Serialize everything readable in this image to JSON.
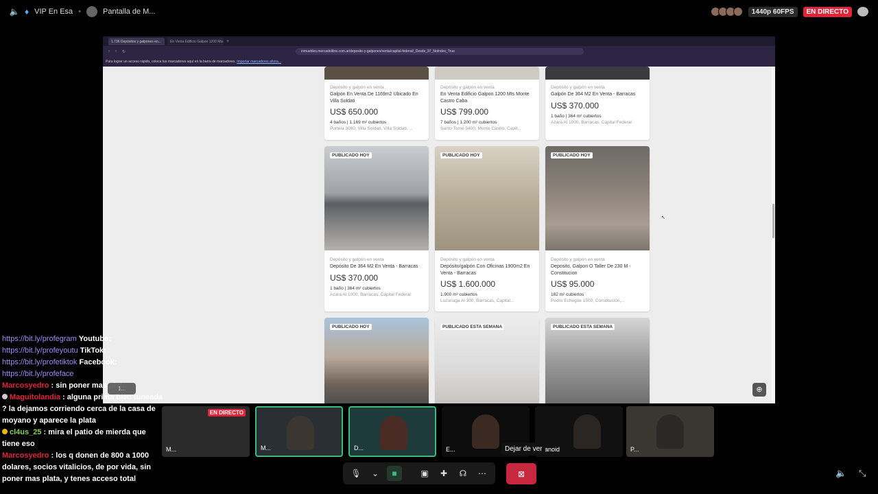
{
  "topbar": {
    "server": "VIP En Esa",
    "activity": "Pantalla de M...",
    "quality": "1440p 60FPS",
    "live": "EN DIRECTO"
  },
  "browser": {
    "tabs": [
      "1.736 Depósitos y galpones en...",
      "En Venta Edificio Galpon 1200 Mts..."
    ],
    "url": "inmuebles.mercadolibre.com.ar/deposito-y-galpones/venta/capital-federal/_Desde_97_NoIndex_True",
    "bookmark_text": "Para lograr un acceso rápido, coloca tus marcadores aquí en la barra de marcadores.",
    "bookmark_link": "Importar marcadores ahora..."
  },
  "listings": [
    {
      "category": "Depósito y galpón en venta",
      "title": "Galpón En Venta De 1169m2 Ubicado En Villa Soldati",
      "price": "US$ 650.000",
      "attrs": "4 baños | 1.169 m² cubiertos",
      "location": "Portela 3060, Villa Soldati, Villa Soldati, ..."
    },
    {
      "category": "Depósito y galpón en venta",
      "title": "En Venta Edificio Galpon 1200 Mts Monte Castro Caba",
      "price": "US$ 799.000",
      "attrs": "7 baños | 1.200 m² cubiertos",
      "location": "Santo Tomé 5400, Monte Castro, Capit..."
    },
    {
      "category": "Depósito y galpón en venta",
      "title": "Galpón De 364 M2 En Venta - Barracas",
      "price": "US$ 370.000",
      "attrs": "1 baño | 364 m² cubiertos",
      "location": "Azara Al 1000, Barracas, Capital Federal"
    },
    {
      "badge": "PUBLICADO HOY",
      "category": "Depósito y galpón en venta",
      "title": "Depósito De 364 M2 En Venta - Barracas",
      "price": "US$ 370.000",
      "attrs": "1 baño | 364 m² cubiertos",
      "location": "Azara Al 1000, Barracas, Capital Federal"
    },
    {
      "badge": "PUBLICADO HOY",
      "category": "Depósito y galpón en venta",
      "title": "Depósito/galpón Con Oficinas 1900m2 En Venta - Barracas",
      "price": "US$ 1.600.000",
      "attrs": "1.900 m² cubiertos",
      "location": "Luzuriaga Al 300, Barracas, Capital..."
    },
    {
      "badge": "PUBLICADO HOY",
      "category": "Depósito y galpón en venta",
      "title": "Deposito, Galpon O Taller De 230 M - Constitucion",
      "price": "US$ 95.000",
      "attrs": "182 m² cubiertos",
      "location": "Pedro Echegüe 1500, Constitución,..."
    },
    {
      "badge": "PUBLICADO HOY"
    },
    {
      "badge": "PUBLICADO ESTA SEMANA"
    },
    {
      "badge": "PUBLICADO ESTA SEMANA"
    }
  ],
  "chat": {
    "links": [
      {
        "url": "https://bit.ly/profegram",
        "label": "Youtube:"
      },
      {
        "url": "https://bit.ly/profeyoutu",
        "label": "TikTok:"
      },
      {
        "url": "https://bit.ly/profetiktok",
        "label": "Facebook:"
      },
      {
        "url": "https://bit.ly/profeface",
        "label": ""
      }
    ],
    "messages": [
      {
        "user": "Marcosyedro",
        "text": "sin poner mas plata"
      },
      {
        "user": "Maguitolandia",
        "text": "alguna prima bien tuneada ? la dejamos corriendo cerca de la casa de moyano y aparece la plata"
      },
      {
        "user": "cl4us_25",
        "text": "mira el patio de mierda que tiene eso"
      },
      {
        "user": "Marcosyedro",
        "text": "los q donen de 800 a 1000 dolares, socios vitalicios, de por vida, sin poner mas plata, y tenes acceso total"
      }
    ],
    "pill": "1..."
  },
  "participants": [
    {
      "name": "M...",
      "live": "EN DIRECTO"
    },
    {
      "name": "M..."
    },
    {
      "name": "D..."
    },
    {
      "name": "E..."
    },
    {
      "name": "aranoid"
    },
    {
      "name": "P..."
    }
  ],
  "tooltip": "Dejar de ver"
}
